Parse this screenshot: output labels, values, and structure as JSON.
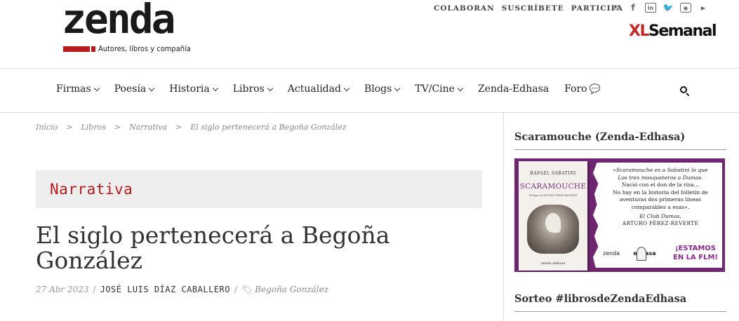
{
  "header": {
    "logo": {
      "wordmark": "zenda",
      "tagline": "Autores, libros y compañía"
    },
    "top_links": [
      "COLABORAN",
      "SUSCRÍBETE",
      "PARTICIPA"
    ],
    "social_icons": [
      "mail-icon",
      "facebook-icon",
      "linkedin-icon",
      "twitter-icon",
      "instagram-icon",
      "youtube-icon"
    ],
    "partner": {
      "prefix": "XL",
      "name": "Semanal"
    }
  },
  "nav": {
    "items": [
      {
        "label": "Firmas",
        "has_dropdown": true
      },
      {
        "label": "Poesía",
        "has_dropdown": true
      },
      {
        "label": "Historia",
        "has_dropdown": true
      },
      {
        "label": "Libros",
        "has_dropdown": true
      },
      {
        "label": "Actualidad",
        "has_dropdown": true
      },
      {
        "label": "Blogs",
        "has_dropdown": true
      },
      {
        "label": "TV/Cine",
        "has_dropdown": true
      },
      {
        "label": "Zenda-Edhasa",
        "has_dropdown": false
      },
      {
        "label": "Foro",
        "has_dropdown": false,
        "icon": "chat-icon"
      }
    ],
    "search_icon": "search-icon"
  },
  "breadcrumb": {
    "items": [
      "Inicio",
      "Libros",
      "Narrativa",
      "El siglo pertenecerá a Begoña González"
    ],
    "separator": ">"
  },
  "article": {
    "category": "Narrativa",
    "title": "El siglo pertenecerá a Begoña González",
    "date": "27 Abr 2023",
    "author": "JOSÉ LUIS DÍAZ CABALLERO",
    "tag": "Begoña González",
    "meta_separator": "/"
  },
  "sidebar": {
    "widget1_title": "Scaramouche (Zenda-Edhasa)",
    "banner": {
      "book_author": "RAFAEL SABATINI",
      "book_title": "SCARAMOUCHE",
      "book_sub": "Prólogo de ARTURO PÉREZ-REVERTE",
      "book_publisher": "zenda edhasa",
      "quote_lines": [
        "«Scaramouche es a Sabatini lo que",
        "Los tres mosqueteros a Dumas.",
        "Nació con el don de la risa…",
        "No hay en la historia del folletín de",
        "aventuras dos primeras líneas",
        "comparables a esas»."
      ],
      "quote_source": "El Club Dumas,",
      "quote_author": "ARTURO PÉREZ-REVERTE",
      "brand_left": "zenda",
      "brand_right": "edhasa",
      "fair_line1": "¡ESTAMOS",
      "fair_line2": "EN LA FLM!"
    },
    "widget2_title": "Sorteo #librosdeZendaEdhasa"
  },
  "colors": {
    "accent_red": "#b71c1c",
    "banner_purple": "#6e2670",
    "text_dark": "#333333",
    "muted": "#999999"
  }
}
